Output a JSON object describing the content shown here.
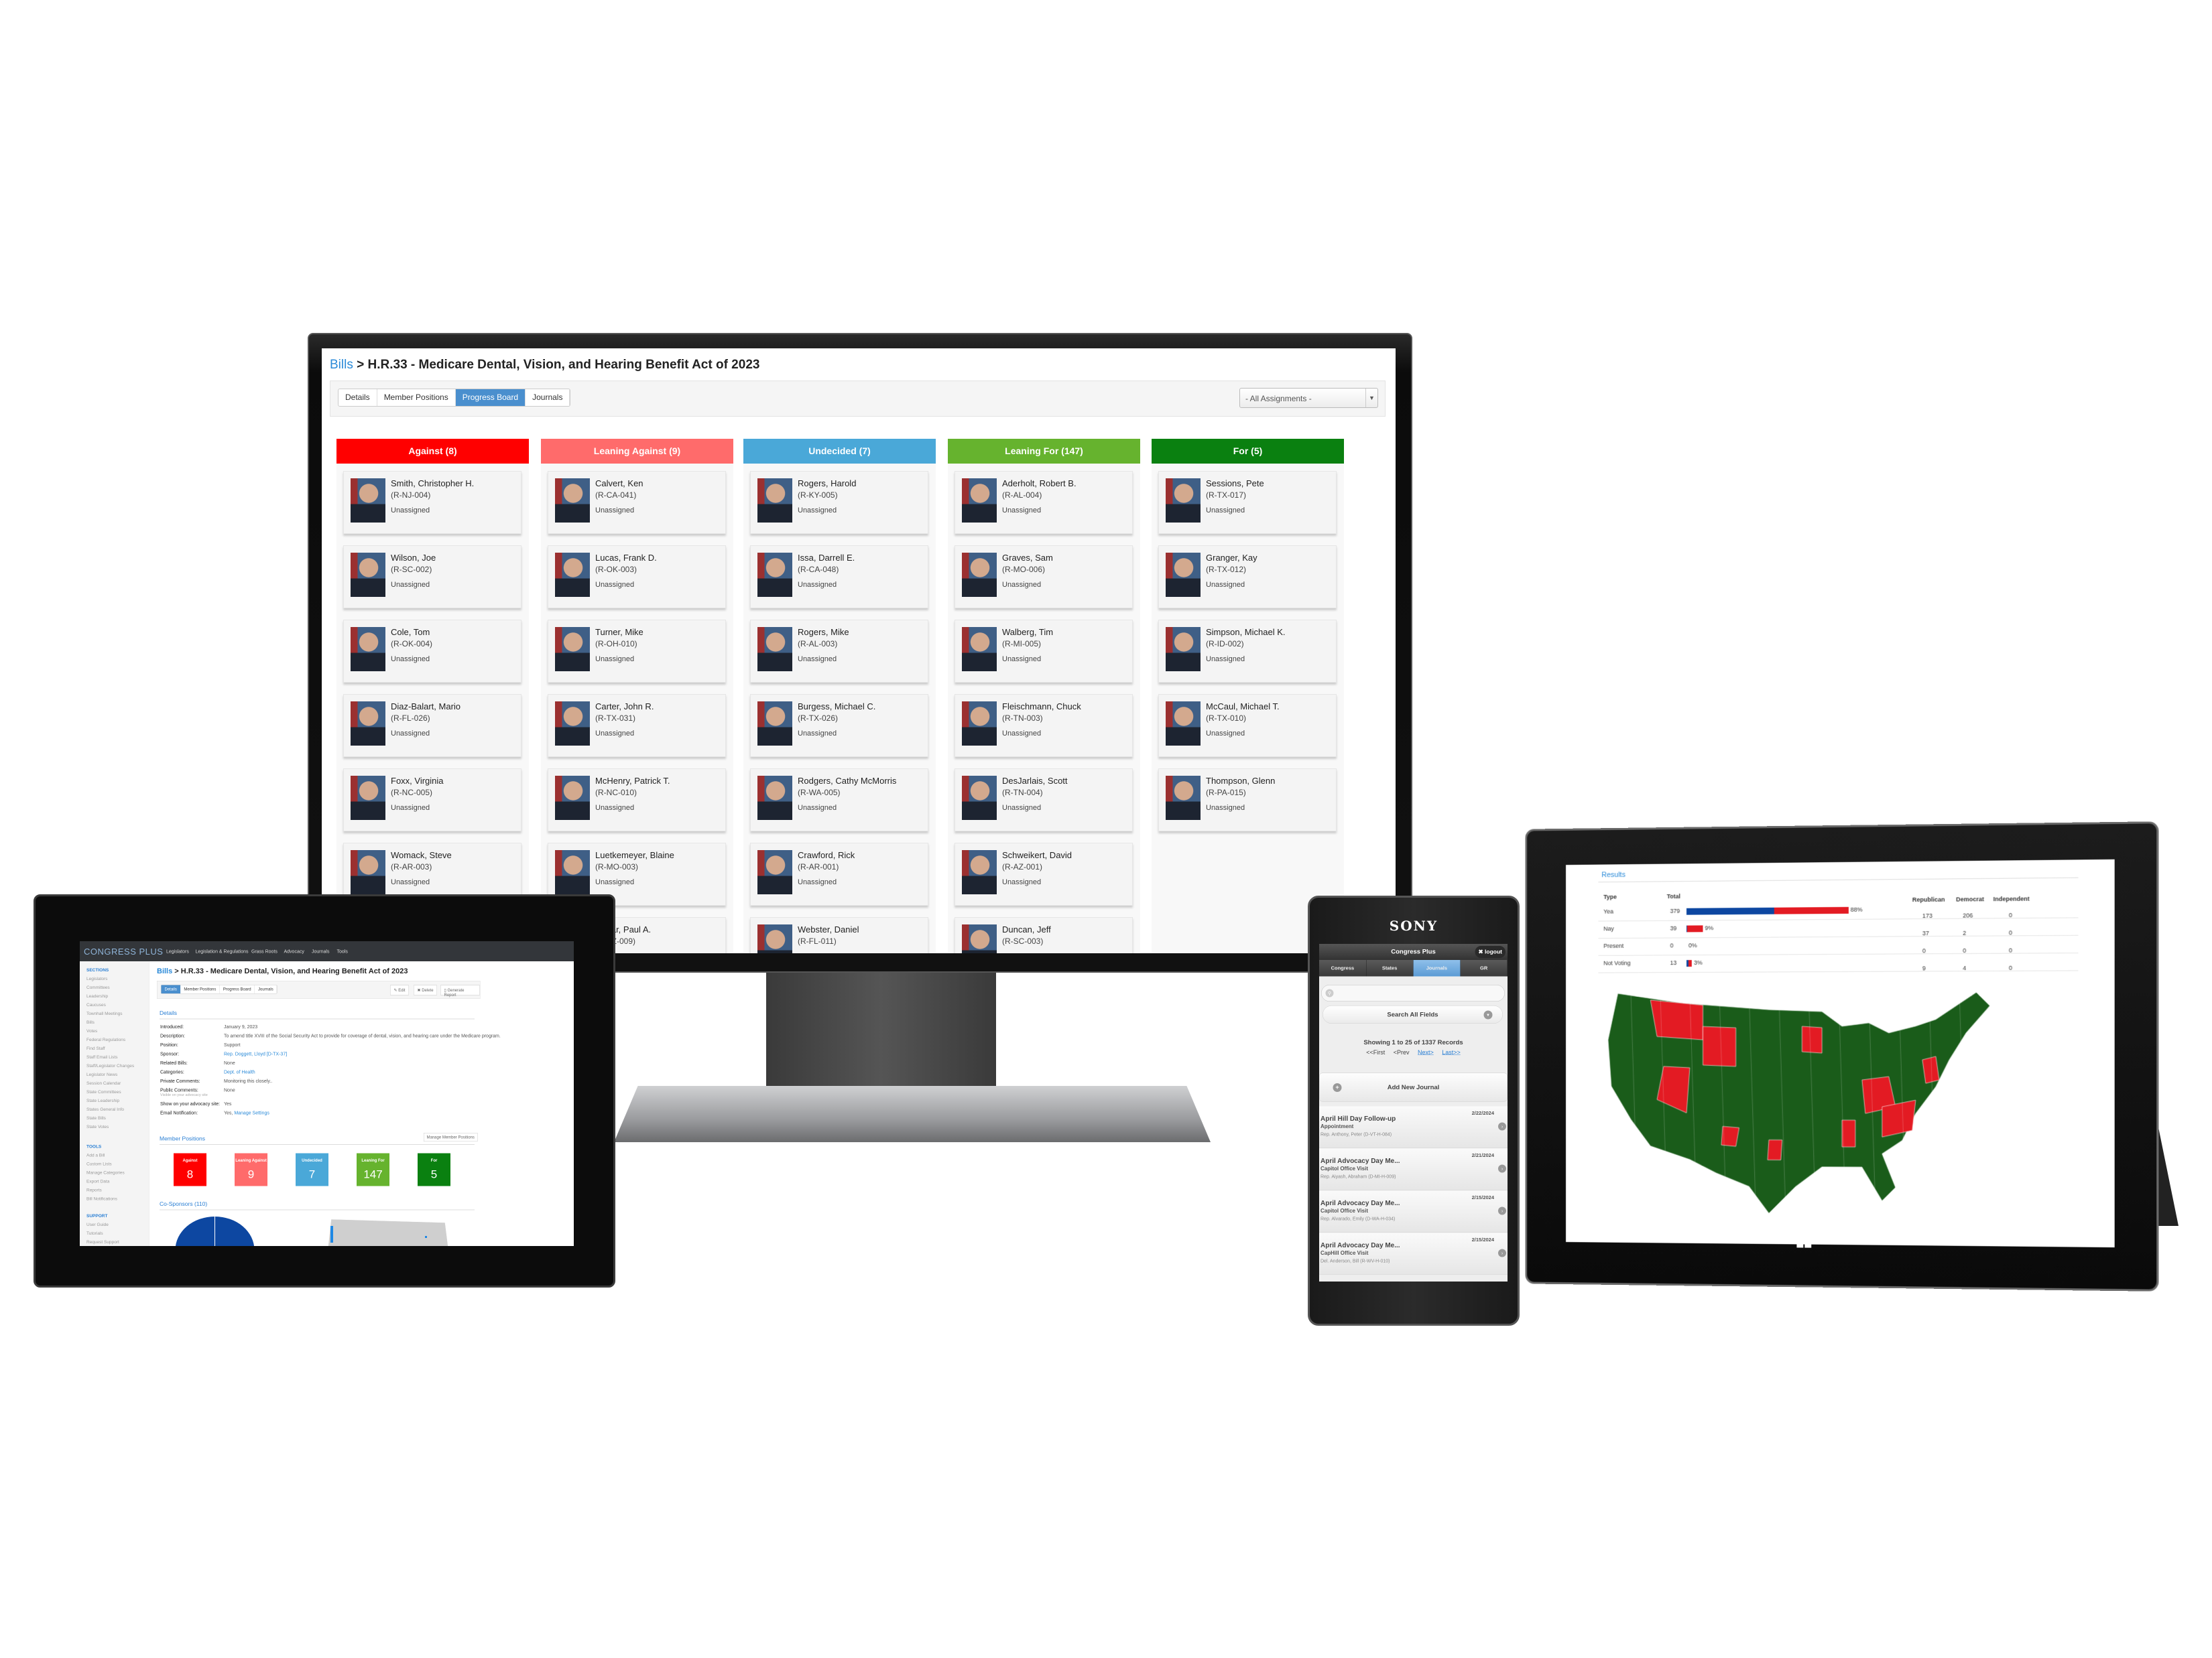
{
  "monitor": {
    "breadcrumb": {
      "root": "Bills",
      "separator": ">",
      "title": "H.R.33 - Medicare Dental, Vision, and Hearing Benefit Act of 2023"
    },
    "tabs": [
      "Details",
      "Member Positions",
      "Progress Board",
      "Journals"
    ],
    "active_tab": "Progress Board",
    "assignment_filter": "- All Assignments -",
    "columns": [
      {
        "title": "Against (8)",
        "color": "#ff0000",
        "cards": [
          {
            "name": "Smith, Christopher H.",
            "district": "(R-NJ-004)",
            "status": "Unassigned"
          },
          {
            "name": "Wilson, Joe",
            "district": "(R-SC-002)",
            "status": "Unassigned"
          },
          {
            "name": "Cole, Tom",
            "district": "(R-OK-004)",
            "status": "Unassigned"
          },
          {
            "name": "Diaz-Balart, Mario",
            "district": "(R-FL-026)",
            "status": "Unassigned"
          },
          {
            "name": "Foxx, Virginia",
            "district": "(R-NC-005)",
            "status": "Unassigned"
          },
          {
            "name": "Womack, Steve",
            "district": "(R-AR-003)",
            "status": "Unassigned"
          }
        ]
      },
      {
        "title": "Leaning Against (9)",
        "color": "#ff6b6b",
        "cards": [
          {
            "name": "Calvert, Ken",
            "district": "(R-CA-041)",
            "status": "Unassigned"
          },
          {
            "name": "Lucas, Frank D.",
            "district": "(R-OK-003)",
            "status": "Unassigned"
          },
          {
            "name": "Turner, Mike",
            "district": "(R-OH-010)",
            "status": "Unassigned"
          },
          {
            "name": "Carter, John R.",
            "district": "(R-TX-031)",
            "status": "Unassigned"
          },
          {
            "name": "McHenry, Patrick T.",
            "district": "(R-NC-010)",
            "status": "Unassigned"
          },
          {
            "name": "Luetkemeyer, Blaine",
            "district": "(R-MO-003)",
            "status": "Unassigned"
          },
          {
            "name": "Gosar, Paul A.",
            "district": "(R-AZ-009)",
            "status": ""
          }
        ]
      },
      {
        "title": "Undecided (7)",
        "color": "#4aa8d8",
        "cards": [
          {
            "name": "Rogers, Harold",
            "district": "(R-KY-005)",
            "status": "Unassigned"
          },
          {
            "name": "Issa, Darrell E.",
            "district": "(R-CA-048)",
            "status": "Unassigned"
          },
          {
            "name": "Rogers, Mike",
            "district": "(R-AL-003)",
            "status": "Unassigned"
          },
          {
            "name": "Burgess, Michael C.",
            "district": "(R-TX-026)",
            "status": "Unassigned"
          },
          {
            "name": "Rodgers, Cathy McMorris",
            "district": "(R-WA-005)",
            "status": "Unassigned"
          },
          {
            "name": "Crawford, Rick",
            "district": "(R-AR-001)",
            "status": "Unassigned"
          },
          {
            "name": "Webster, Daniel",
            "district": "(R-FL-011)",
            "status": ""
          }
        ]
      },
      {
        "title": "Leaning For (147)",
        "color": "#66b32e",
        "cards": [
          {
            "name": "Aderholt, Robert B.",
            "district": "(R-AL-004)",
            "status": "Unassigned"
          },
          {
            "name": "Graves, Sam",
            "district": "(R-MO-006)",
            "status": "Unassigned"
          },
          {
            "name": "Walberg, Tim",
            "district": "(R-MI-005)",
            "status": "Unassigned"
          },
          {
            "name": "Fleischmann, Chuck",
            "district": "(R-TN-003)",
            "status": "Unassigned"
          },
          {
            "name": "DesJarlais, Scott",
            "district": "(R-TN-004)",
            "status": "Unassigned"
          },
          {
            "name": "Schweikert, David",
            "district": "(R-AZ-001)",
            "status": "Unassigned"
          },
          {
            "name": "Duncan, Jeff",
            "district": "(R-SC-003)",
            "status": ""
          }
        ]
      },
      {
        "title": "For (5)",
        "color": "#0a8010",
        "cards": [
          {
            "name": "Sessions, Pete",
            "district": "(R-TX-017)",
            "status": "Unassigned"
          },
          {
            "name": "Granger, Kay",
            "district": "(R-TX-012)",
            "status": "Unassigned"
          },
          {
            "name": "Simpson, Michael K.",
            "district": "(R-ID-002)",
            "status": "Unassigned"
          },
          {
            "name": "McCaul, Michael T.",
            "district": "(R-TX-010)",
            "status": "Unassigned"
          },
          {
            "name": "Thompson, Glenn",
            "district": "(R-PA-015)",
            "status": "Unassigned"
          }
        ]
      }
    ]
  },
  "tablet": {
    "logo": "CONGRESS PLUS",
    "nav": [
      "Legislators",
      "Legislation & Regulations",
      "Grass Roots",
      "Advocacy",
      "Journals",
      "Tools"
    ],
    "sidebar": {
      "sections_title": "SECTIONS",
      "sections": [
        "Legislators",
        "Committees",
        "Leadership",
        "Caucuses",
        "Townhall Meetings",
        "Bills",
        "Votes",
        "Federal Regulations",
        "Find Staff",
        "Staff Email Lists",
        "Staff/Legislator Changes",
        "Legislator News",
        "Session Calendar",
        "State Committees",
        "State Leadership",
        "States General Info",
        "State Bills",
        "State Votes"
      ],
      "tools_title": "TOOLS",
      "tools": [
        "Add a Bill",
        "Custom Lists",
        "Manage Categories",
        "Export Data",
        "Reports",
        "Bill Notifications"
      ],
      "support_title": "SUPPORT",
      "support": [
        "User Guide",
        "Tutorials",
        "Request Support",
        "Release Notes"
      ]
    },
    "breadcrumb": {
      "root": "Bills",
      "separator": ">",
      "title": "H.R.33 - Medicare Dental, Vision, and Hearing Benefit Act of 2023"
    },
    "tabs": [
      "Details",
      "Member Positions",
      "Progress Board",
      "Journals"
    ],
    "active_tab": "Details",
    "actions": [
      "Edit",
      "Delete",
      "Generate Report"
    ],
    "details_title": "Details",
    "details": [
      {
        "label": "Introduced:",
        "value": "January 9, 2023"
      },
      {
        "label": "Description:",
        "value": "To amend title XVIII of the Social Security Act to provide for coverage of dental, vision, and hearing care under the Medicare program."
      },
      {
        "label": "Position:",
        "value": "Support"
      },
      {
        "label": "Sponsor:",
        "value": "Rep. Doggett, Lloyd [D-TX-37]",
        "link": true
      },
      {
        "label": "Related Bills:",
        "value": "None"
      },
      {
        "label": "Categories:",
        "value": "Dept. of Health",
        "link": true
      },
      {
        "label": "Private Comments:",
        "value": "Monitoring this closely.."
      },
      {
        "label": "Public Comments:",
        "value": "None",
        "note": "Visible on your advocacy site"
      },
      {
        "label": "Show on your advocacy site:",
        "value": "Yes"
      },
      {
        "label": "Email Notification:",
        "value": "Yes,",
        "link_text": "Manage Settings"
      }
    ],
    "member_positions_title": "Member Positions",
    "manage_positions": "Manage Member Positions",
    "positions": [
      {
        "label": "Against",
        "value": "8",
        "color": "#ff0000"
      },
      {
        "label": "Leaning Against",
        "value": "9",
        "color": "#ff6b6b"
      },
      {
        "label": "Undecided",
        "value": "7",
        "color": "#4aa8d8"
      },
      {
        "label": "Leaning For",
        "value": "147",
        "color": "#66b32e"
      },
      {
        "label": "For",
        "value": "5",
        "color": "#0a8010"
      }
    ],
    "cosponsors_title": "Co-Sponsors (110)"
  },
  "phone": {
    "brand": "SONY",
    "title": "Congress Plus",
    "logout": "logout",
    "tabs": [
      "Congress",
      "States",
      "Journals",
      "GR"
    ],
    "active_tab": "Journals",
    "search_placeholder": "",
    "search_scope": "Search All Fields",
    "showing": "Showing 1 to 25 of 1337 Records",
    "pager": {
      "first": "<<First",
      "prev": "<Prev",
      "next": "Next>",
      "last": "Last>>"
    },
    "add_journal": "Add New Journal",
    "journals": [
      {
        "title": "April Hill Day Follow-up",
        "type": "Appointment",
        "member": "Rep. Anthony, Peter (D-VT-H-084)",
        "date": "2/22/2024"
      },
      {
        "title": "April Advocacy Day Me...",
        "type": "Capitol Office Visit",
        "member": "Rep. Aiyash, Abraham (D-MI-H-009)",
        "date": "2/21/2024"
      },
      {
        "title": "April Advocacy Day Me...",
        "type": "Capitol Office Visit",
        "member": "Rep. Alvarado, Emily (D-WA-H-034)",
        "date": "2/15/2024"
      },
      {
        "title": "April Advocacy Day Me...",
        "type": "CapHill Office Visit",
        "member": "Del. Anderson, Bill (R-WV-H-010)",
        "date": "2/15/2024"
      }
    ]
  },
  "surface": {
    "results_title": "Results",
    "headers": [
      "Type",
      "Total",
      "Republican",
      "Democrat",
      "Independent"
    ],
    "colors": {
      "democrat": "#0d47a1",
      "republican": "#e31b23",
      "map_base": "#1a5c1a"
    },
    "rows": [
      {
        "type": "Yea",
        "total": "379",
        "pct": "88%",
        "pct_value": 88,
        "republican": "173",
        "democrat": "206",
        "independent": "0"
      },
      {
        "type": "Nay",
        "total": "39",
        "pct": "9%",
        "pct_value": 9,
        "republican": "37",
        "democrat": "2",
        "independent": "0"
      },
      {
        "type": "Present",
        "total": "0",
        "pct": "0%",
        "pct_value": 0,
        "republican": "0",
        "democrat": "0",
        "independent": "0"
      },
      {
        "type": "Not Voting",
        "total": "13",
        "pct": "3%",
        "pct_value": 3,
        "republican": "9",
        "democrat": "4",
        "independent": "0"
      }
    ]
  }
}
